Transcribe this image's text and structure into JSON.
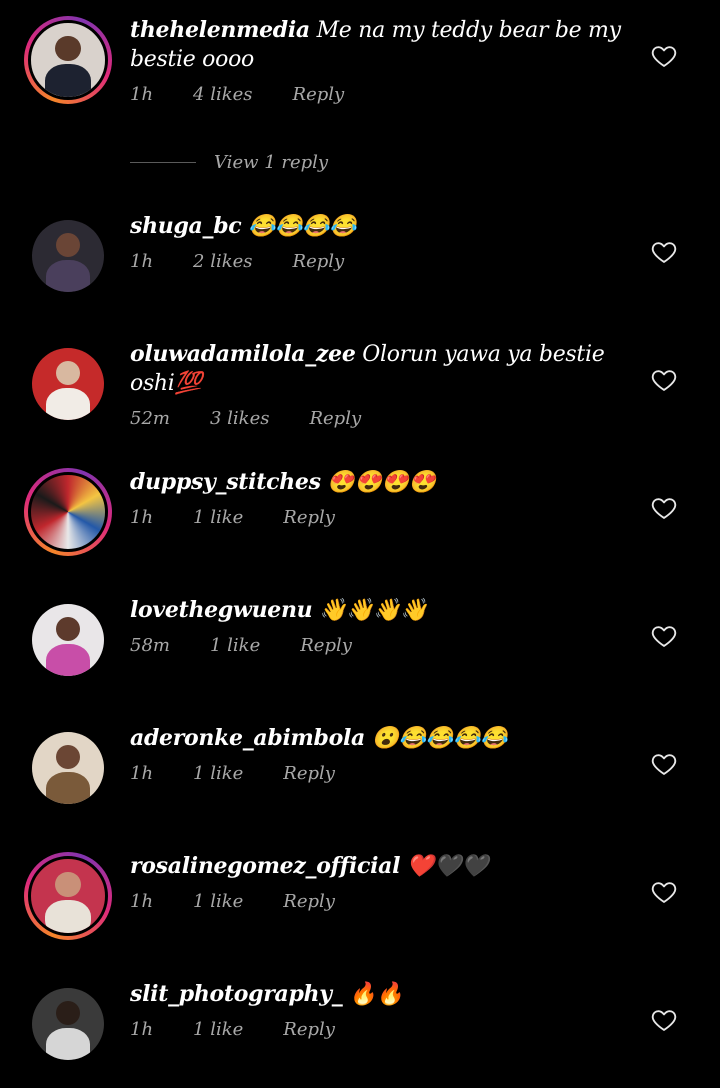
{
  "colors": {
    "background": "#000000",
    "text_primary": "#ffffff",
    "text_secondary": "#a8a8a8",
    "story_ring": "#dd2a7b"
  },
  "comments": [
    {
      "username": "thehelenmedia",
      "text": "Me na my teddy bear be my bestie oooo",
      "time": "1h",
      "likes": "4 likes",
      "reply_label": "Reply",
      "story_ring": true
    },
    {
      "username": "shuga_bc",
      "text": "😂😂😂😂",
      "time": "1h",
      "likes": "2 likes",
      "reply_label": "Reply",
      "story_ring": false
    },
    {
      "username": "oluwadamilola_zee",
      "text": "Olorun yawa ya bestie oshi💯",
      "time": "52m",
      "likes": "3 likes",
      "reply_label": "Reply",
      "story_ring": false
    },
    {
      "username": "duppsy_stitches",
      "text": "😍😍😍😍",
      "time": "1h",
      "likes": "1 like",
      "reply_label": "Reply",
      "story_ring": true
    },
    {
      "username": "lovethegwuenu",
      "text": "👋👋👋👋",
      "time": "58m",
      "likes": "1 like",
      "reply_label": "Reply",
      "story_ring": false
    },
    {
      "username": "aderonke_abimbola",
      "text": "😮😂😂😂😂",
      "time": "1h",
      "likes": "1 like",
      "reply_label": "Reply",
      "story_ring": false
    },
    {
      "username": "rosalinegomez_official",
      "text": "❤️🖤🖤",
      "time": "1h",
      "likes": "1 like",
      "reply_label": "Reply",
      "story_ring": true
    },
    {
      "username": "slit_photography_",
      "text": "🔥🔥",
      "time": "1h",
      "likes": "1 like",
      "reply_label": "Reply",
      "story_ring": false
    }
  ],
  "view_replies": {
    "label": "View 1 reply"
  },
  "icons": {
    "like": "heart-outline-icon",
    "avatar": "profile-photo"
  }
}
